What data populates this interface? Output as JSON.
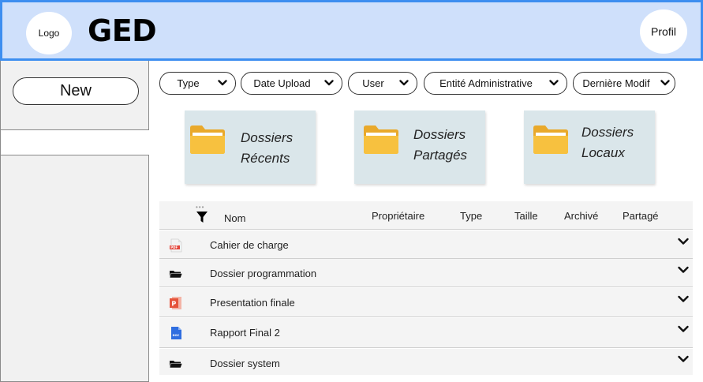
{
  "header": {
    "logo": "Logo",
    "title": "GED",
    "profile": "Profil"
  },
  "sidebar": {
    "new_label": "New"
  },
  "filters": [
    {
      "label": "Type"
    },
    {
      "label": "Date Upload"
    },
    {
      "label": "User"
    },
    {
      "label": "Entité Administrative"
    },
    {
      "label": "Dernière Modif"
    }
  ],
  "folders": [
    {
      "line1": "Dossiers",
      "line2": "Récents"
    },
    {
      "line1": "Dossiers",
      "line2": "Partagés"
    },
    {
      "line1": "Dossiers",
      "line2": "Locaux"
    }
  ],
  "table": {
    "columns": {
      "nom": "Nom",
      "proprietaire": "Propriétaire",
      "type": "Type",
      "taille": "Taille",
      "archive": "Archivé",
      "partage": "Partagé"
    },
    "rows": [
      {
        "name": "Cahier de charge",
        "icon": "pdf-file-icon"
      },
      {
        "name": "Dossier programmation",
        "icon": "folder-icon"
      },
      {
        "name": "Presentation finale",
        "icon": "powerpoint-file-icon"
      },
      {
        "name": "Rapport Final 2",
        "icon": "doc-file-icon"
      },
      {
        "name": "Dossier system",
        "icon": "folder-icon"
      }
    ]
  },
  "colors": {
    "header_bg": "#cfe0fb",
    "header_border": "#3d8ef0",
    "card_bg": "#dae6ea",
    "folder_yellow": "#f7c13f",
    "pdf_red": "#e3463b",
    "ppt_orange": "#e5533a",
    "doc_blue": "#2f6ee0"
  }
}
